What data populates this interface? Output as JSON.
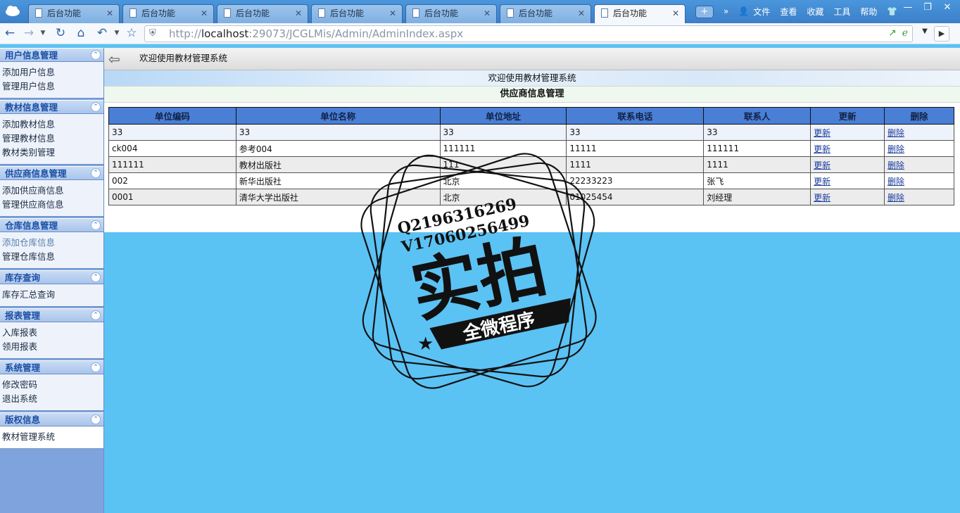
{
  "browser": {
    "tabs": [
      {
        "label": "后台功能",
        "close": "✕"
      },
      {
        "label": "后台功能",
        "close": "✕"
      },
      {
        "label": "后台功能",
        "close": "✕"
      },
      {
        "label": "后台功能",
        "close": "✕"
      },
      {
        "label": "后台功能",
        "close": "✕"
      },
      {
        "label": "后台功能",
        "close": "✕"
      },
      {
        "label": "后台功能",
        "close": "✕"
      }
    ],
    "new_tab": "+",
    "menu": [
      "»",
      "文件",
      "查看",
      "收藏",
      "工具",
      "帮助"
    ],
    "url_prefix": "http://",
    "url_host": "localhost",
    "url_rest": ":29073/JCGLMis/Admin/AdminIndex.aspx"
  },
  "sidebar": {
    "groups": [
      {
        "title": "用户信息管理",
        "items": [
          "添加用户信息",
          "管理用户信息"
        ]
      },
      {
        "title": "教材信息管理",
        "items": [
          "添加教材信息",
          "管理教材信息",
          "教材类别管理"
        ]
      },
      {
        "title": "供应商信息管理",
        "items": [
          "添加供应商信息",
          "管理供应商信息"
        ]
      },
      {
        "title": "仓库信息管理",
        "items": [
          "添加仓库信息",
          "管理仓库信息"
        ]
      },
      {
        "title": "库存查询",
        "items": [
          "库存汇总查询"
        ]
      },
      {
        "title": "报表管理",
        "items": [
          "入库报表",
          "领用报表"
        ]
      },
      {
        "title": "系统管理",
        "items": [
          "修改密码",
          "退出系统"
        ]
      },
      {
        "title": "版权信息",
        "items": [
          "教材管理系统"
        ]
      }
    ]
  },
  "content": {
    "top_title": "欢迎使用教材管理系统",
    "welcome": "欢迎使用教材管理系统",
    "section_title": "供应商信息管理",
    "table": {
      "headers": [
        "单位编码",
        "单位名称",
        "单位地址",
        "联系电话",
        "联系人",
        "更新",
        "删除"
      ],
      "rows": [
        [
          "33",
          "33",
          "33",
          "33",
          "33",
          "更新",
          "删除"
        ],
        [
          "ck004",
          "参考004",
          "111111",
          "11111",
          "111111",
          "更新",
          "删除"
        ],
        [
          "111111",
          "教材出版社",
          "111",
          "1111",
          "1111",
          "更新",
          "删除"
        ],
        [
          "002",
          "新华出版社",
          "北京",
          "22233223",
          "张飞",
          "更新",
          "删除"
        ],
        [
          "0001",
          "清华大学出版社",
          "北京",
          "01025454",
          "刘经理",
          "更新",
          "删除"
        ]
      ]
    }
  },
  "watermark": {
    "line1": "Q2196316269",
    "line2": "V17060256499",
    "big": "实拍",
    "ribbon": "全微程序"
  }
}
